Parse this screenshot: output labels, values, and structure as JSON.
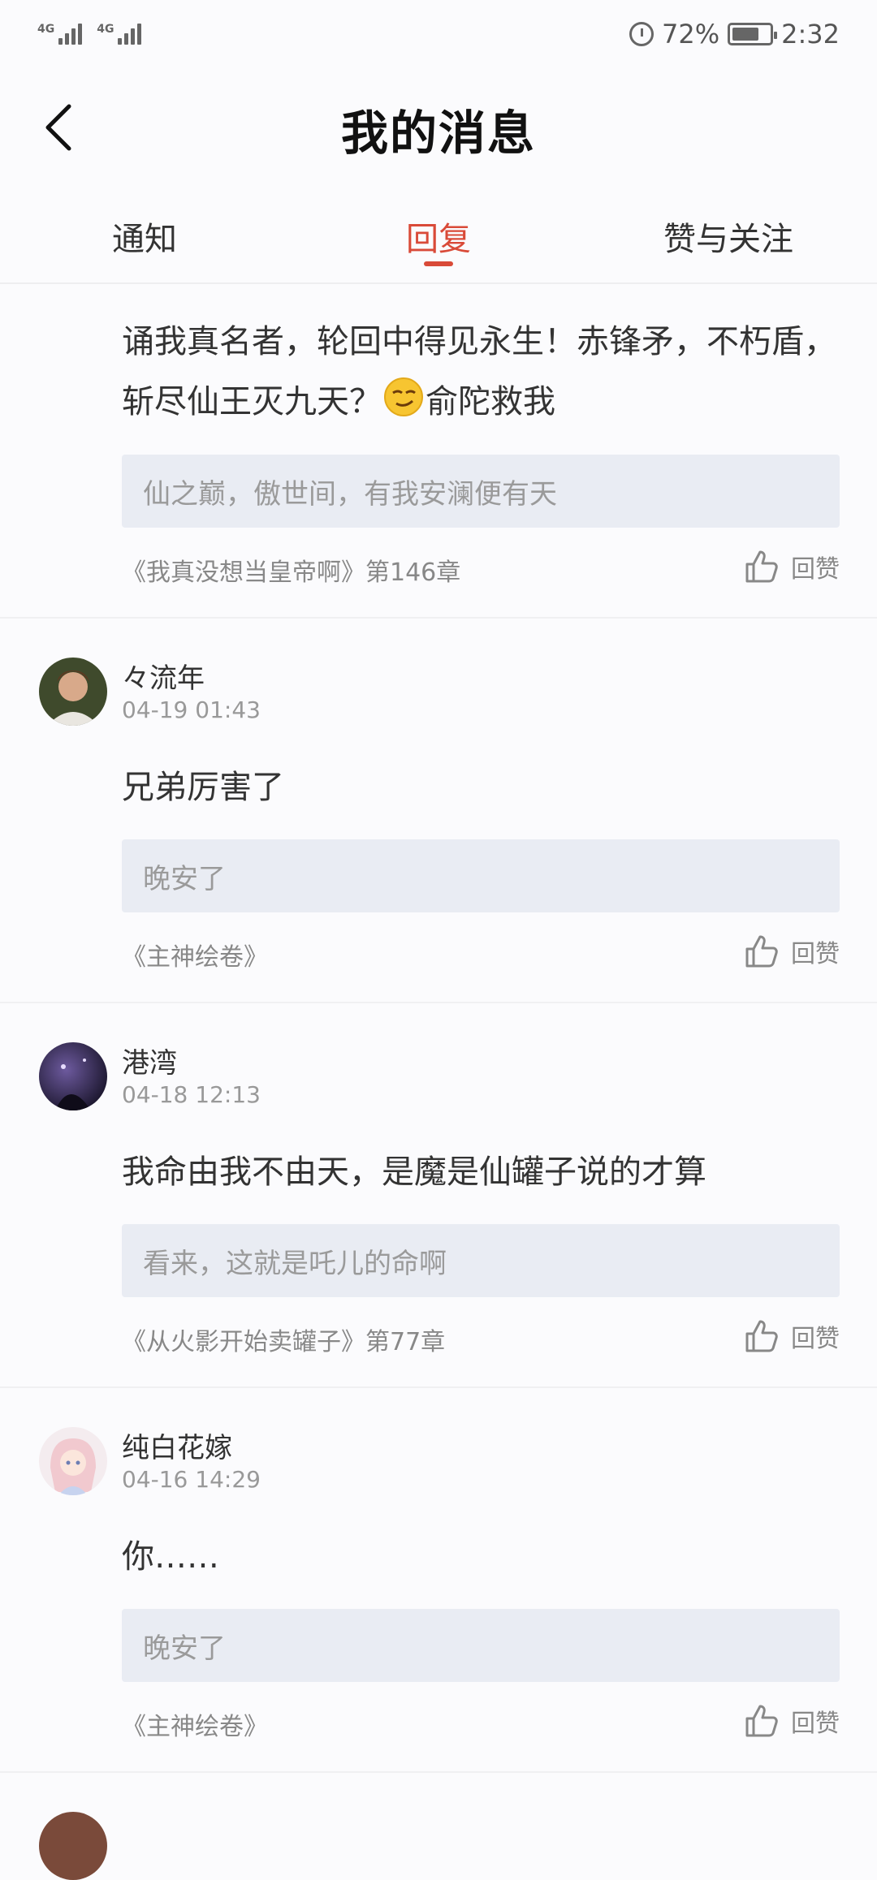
{
  "status_bar": {
    "signal_labels": [
      "4G",
      "4G"
    ],
    "battery": "72%",
    "time": "2:32"
  },
  "header": {
    "title": "我的消息"
  },
  "tabs": [
    {
      "label": "通知",
      "active": false
    },
    {
      "label": "回复",
      "active": true
    },
    {
      "label": "赞与关注",
      "active": false
    }
  ],
  "colors": {
    "accent": "#d94a38",
    "quote_bg": "#e9ecf3"
  },
  "items": [
    {
      "content_a": "诵我真名者，轮回中得见永生！赤锋矛，不朽盾，斩尽仙王灭九天？",
      "emoji": "smirk-emoji",
      "content_b": "俞陀救我",
      "quote": "仙之巅，傲世间，有我安澜便有天",
      "book": "《我真没想当皇帝啊》第146章",
      "like_label": "回赞"
    },
    {
      "author": "々流年",
      "date": "04-19 01:43",
      "content": "兄弟厉害了",
      "quote": "晚安了",
      "book": "《主神绘卷》",
      "like_label": "回赞"
    },
    {
      "author": "港湾",
      "date": "04-18 12:13",
      "content": "我命由我不由天，是魔是仙罐子说的才算",
      "quote": "看来，这就是吒儿的命啊",
      "book": "《从火影开始卖罐子》第77章",
      "like_label": "回赞"
    },
    {
      "author": "纯白花嫁",
      "date": "04-16 14:29",
      "content": "你……",
      "quote": "晚安了",
      "book": "《主神绘卷》",
      "like_label": "回赞"
    }
  ]
}
